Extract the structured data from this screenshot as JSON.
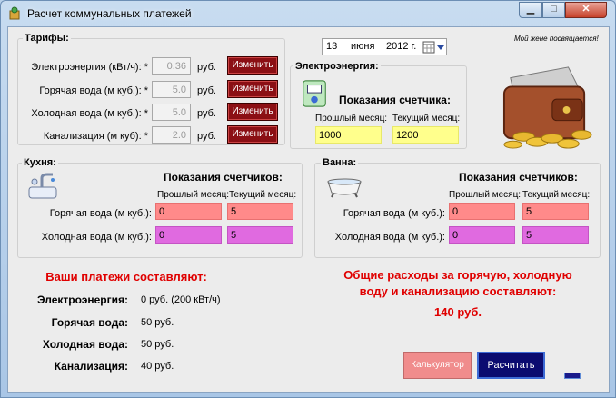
{
  "window": {
    "title": "Расчет коммунальных платежей",
    "min_glyph": "▁",
    "max_glyph": "□",
    "close_glyph": "✕"
  },
  "slogan": "Мой жене посвящается!",
  "date": {
    "day": "13",
    "month": "июня",
    "year": "2012 г."
  },
  "tariffs": {
    "legend": "Тарифы:",
    "unit": "руб.",
    "button_label": "Изменить",
    "rows": [
      {
        "label": "Электроэнергия (кВт/ч): *",
        "value": "0.36"
      },
      {
        "label": "Горячая вода (м куб.): *",
        "value": "5.0"
      },
      {
        "label": "Холодная вода (м куб.): *",
        "value": "5.0"
      },
      {
        "label": "Канализация (м куб): *",
        "value": "2.0"
      }
    ]
  },
  "electricity": {
    "legend": "Электроэнергия:",
    "heading": "Показания счетчика:",
    "prev_label": "Прошлый месяц:",
    "curr_label": "Текущий месяц:",
    "prev_value": "1000",
    "curr_value": "1200"
  },
  "kitchen": {
    "legend": "Кухня:",
    "heading": "Показания счетчиков:",
    "prev_label": "Прошлый месяц:",
    "curr_label": "Текущий месяц:",
    "rows": [
      {
        "label": "Горячая вода (м куб.):",
        "prev": "0",
        "curr": "5"
      },
      {
        "label": "Холодная вода (м куб.):",
        "prev": "0",
        "curr": "5"
      }
    ]
  },
  "bath": {
    "legend": "Ванна:",
    "heading": "Показания счетчиков:",
    "prev_label": "Прошлый месяц:",
    "curr_label": "Текущий месяц:",
    "rows": [
      {
        "label": "Горячая вода (м куб.):",
        "prev": "0",
        "curr": "5"
      },
      {
        "label": "Холодная вода (м куб.):",
        "prev": "0",
        "curr": "5"
      }
    ]
  },
  "payments": {
    "title": "Ваши платежи составляют:",
    "rows": [
      {
        "label": "Электроэнергия:",
        "value": "0 руб. (200 кВт/ч)"
      },
      {
        "label": "Горячая вода:",
        "value": "50 руб."
      },
      {
        "label": "Холодная вода:",
        "value": "50 руб."
      },
      {
        "label": "Канализация:",
        "value": "40 руб."
      }
    ]
  },
  "total": {
    "line1": "Общие расходы за горячую, холодную",
    "line2": "воду и канализацию составляют:",
    "value": "140 руб."
  },
  "buttons": {
    "calculator": "Калькулятор",
    "calculate": "Расчитать"
  },
  "colors": {
    "input_yellow": "#ffff8c",
    "input_pink": "#ff8a8a",
    "input_violet": "#e06ae0",
    "tariff_button": "#8b0f14",
    "calculate_button": "#0b0b70",
    "calculator_button": "#f08c8c",
    "highlight_red": "#e00000"
  },
  "icons": [
    "app-icon",
    "wallet-coins-icon",
    "electric-meter-icon",
    "kitchen-faucet-icon",
    "bathtub-icon",
    "calendar-dropdown-icon"
  ]
}
